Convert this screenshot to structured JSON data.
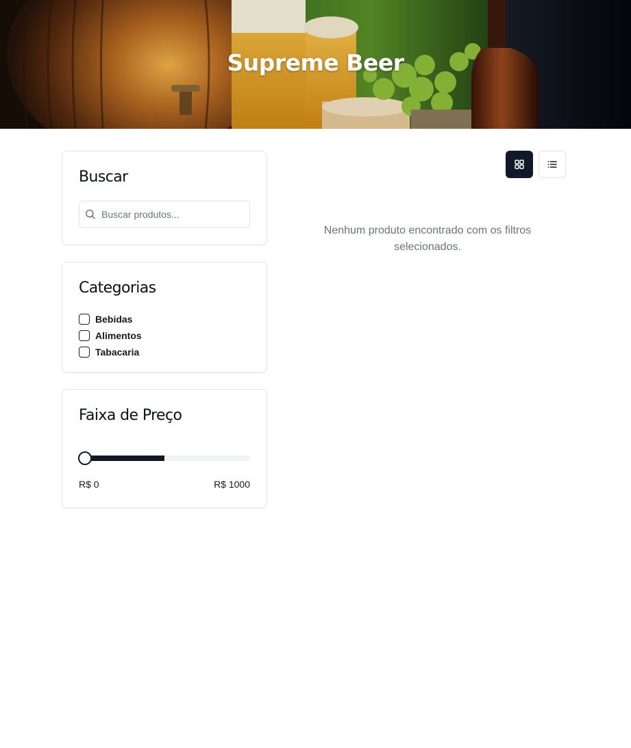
{
  "hero": {
    "title": "Supreme Beer"
  },
  "search": {
    "title": "Buscar",
    "placeholder": "Buscar produtos...",
    "value": ""
  },
  "categories": {
    "title": "Categorias",
    "items": [
      {
        "label": "Bebidas",
        "checked": false
      },
      {
        "label": "Alimentos",
        "checked": false
      },
      {
        "label": "Tabacaria",
        "checked": false
      }
    ]
  },
  "price": {
    "title": "Faixa de Preço",
    "min_label": "R$ 0",
    "max_label": "R$ 1000",
    "min_value": 0,
    "max_value": 1000
  },
  "view": {
    "active": "grid",
    "options": [
      "grid",
      "list"
    ]
  },
  "results": {
    "empty_message": "Nenhum produto encontrado com os filtros selecionados."
  },
  "colors": {
    "primary": "#111827",
    "muted_text": "#6b7280",
    "border": "#e4e6ea"
  }
}
